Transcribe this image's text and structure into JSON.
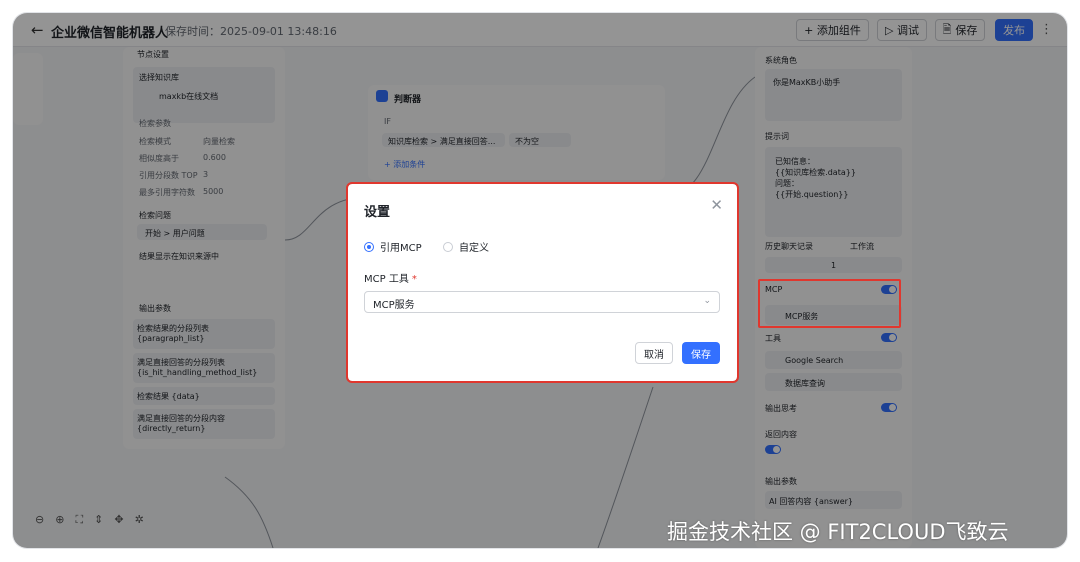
{
  "header": {
    "back_icon": "arrow-left-icon",
    "title": "企业微信智能机器人",
    "save_time": "保存时间：2025-09-01 13:48:16",
    "add_component": "+ 添加组件",
    "debug": "▷ 调试",
    "save": "保存",
    "publish": "发布"
  },
  "left_node": {
    "section_title": "节点设置",
    "kb_label": "选择知识库",
    "kb_item": "maxkb在线文档",
    "search_params": "检索参数",
    "params": [
      {
        "k": "检索模式",
        "v": "向量检索"
      },
      {
        "k": "相似度高于",
        "v": "0.600"
      },
      {
        "k": "引用分段数 TOP",
        "v": "3"
      },
      {
        "k": "最多引用字符数",
        "v": "5000"
      }
    ],
    "question_label": "检索问题",
    "question_value": "开始 > 用户问题",
    "show_in_source": "结果显示在知识来源中",
    "output_title": "输出参数",
    "outputs": [
      "检索结果的分段列表 {paragraph_list}",
      "满足直接回答的分段列表 {is_hit_handling_method_list}",
      "检索结果 {data}",
      "满足直接回答的分段内容 {directly_return}"
    ]
  },
  "judge_node": {
    "title": "判断器",
    "if_label": "IF",
    "condition_field": "知识库检索 > 满足直接回答...",
    "condition_op": "不为空",
    "add_condition": "+ 添加条件"
  },
  "right_node": {
    "system_role": "系统角色",
    "system_role_value": "你是MaxKB小助手",
    "prompt_label": "提示词",
    "prompt_lines": [
      "已知信息：",
      "{{知识库检索.data}}",
      "问题：",
      "{{开始.question}}"
    ],
    "history_label": "历史聊天记录",
    "history_mode": "工作流",
    "history_count": "1",
    "mcp_label": "MCP",
    "mcp_item": "MCP服务",
    "tools_label": "工具",
    "tools": [
      "Google Search",
      "数据库查询"
    ],
    "output_think": "输出思考",
    "return_content": "返回内容",
    "output_params": "输出参数",
    "answer": "AI 回答内容 {answer}"
  },
  "modal": {
    "title": "设置",
    "radio_mcp": "引用MCP",
    "radio_custom": "自定义",
    "field_label": "MCP 工具",
    "field_required": "*",
    "selected": "MCP服务",
    "cancel": "取消",
    "confirm": "保存"
  },
  "watermark": "掘金技术社区 @ FIT2CLOUD飞致云",
  "colors": {
    "primary": "#3370ff",
    "highlight": "#e0372e"
  }
}
